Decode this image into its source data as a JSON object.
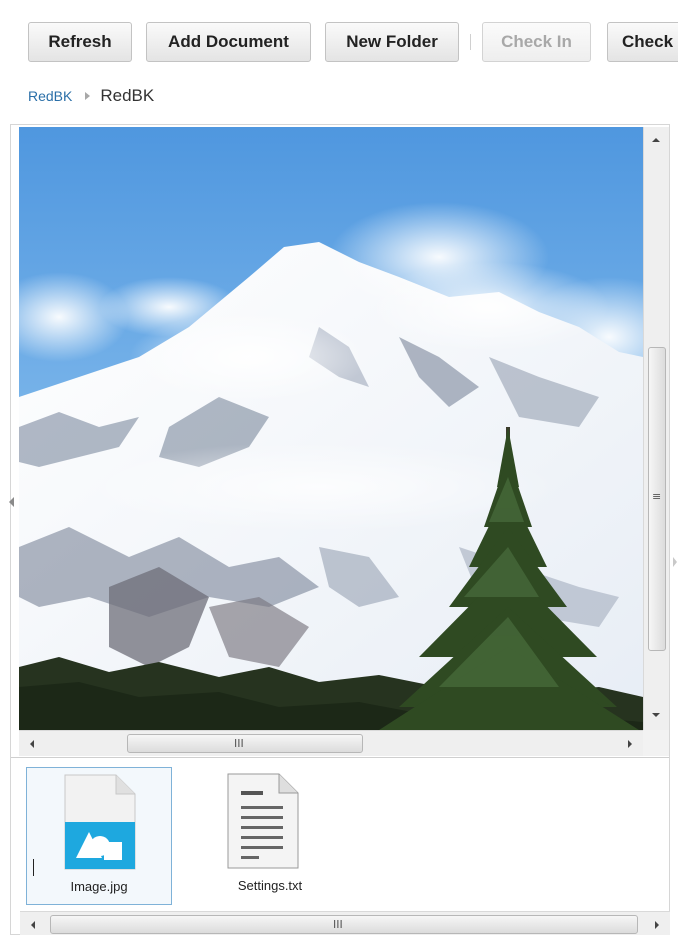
{
  "toolbar": {
    "buttons": [
      {
        "label": "Refresh",
        "enabled": true
      },
      {
        "label": "Add Document",
        "enabled": true
      },
      {
        "label": "New Folder",
        "enabled": true
      },
      {
        "label": "Check In",
        "enabled": false
      },
      {
        "label": "Check",
        "enabled": true
      }
    ]
  },
  "breadcrumb": {
    "root": "RedBK",
    "current": "RedBK"
  },
  "preview": {
    "description_icon": "mountain-photo"
  },
  "scrollbars": {
    "grip_glyph_v": "≡",
    "grip_glyph_h": "III"
  },
  "files": [
    {
      "name": "Image.jpg",
      "icon": "image-file-icon",
      "selected": true
    },
    {
      "name": "Settings.txt",
      "icon": "text-file-icon",
      "selected": false
    }
  ],
  "colors": {
    "link": "#2a6fa8",
    "selection_border": "#7fb2d8",
    "image_icon_blue": "#1ea8df"
  }
}
